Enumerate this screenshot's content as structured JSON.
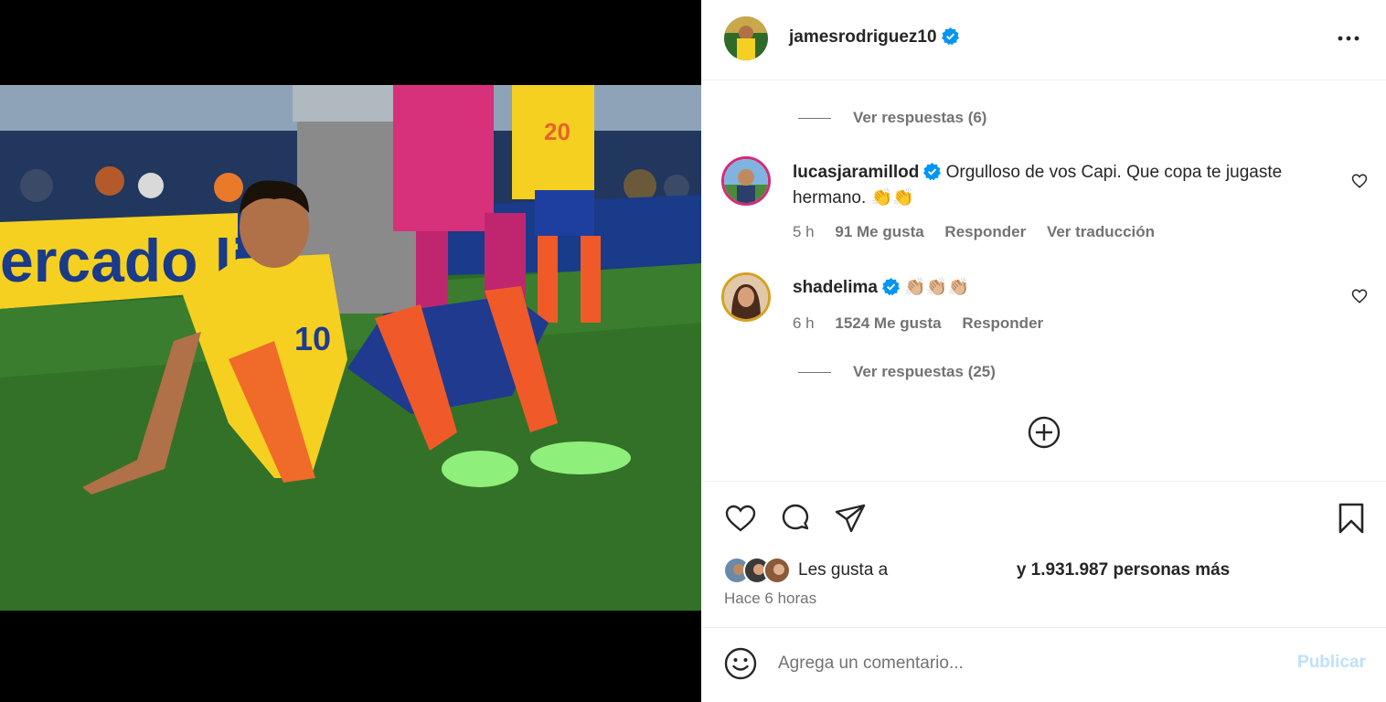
{
  "post": {
    "author": "jamesrodriguez10",
    "more_icon": "more-horizontal-icon"
  },
  "comments": {
    "replies_top": "Ver respuestas (6)",
    "items": [
      {
        "username": "lucasjaramillod",
        "text": "Orgulloso de vos Capi. Que copa te jugaste hermano. 👏👏",
        "time": "5 h",
        "likes": "91 Me gusta",
        "reply": "Responder",
        "translate": "Ver traducción"
      },
      {
        "username": "shadelima",
        "text": "👏🏼👏🏼👏🏼",
        "time": "6 h",
        "likes": "1524 Me gusta",
        "reply": "Responder"
      }
    ],
    "replies_bottom": "Ver respuestas (25)"
  },
  "actions": {
    "liked_by_prefix": "Les gusta a",
    "liked_by_count": "y 1.931.987 personas más",
    "time_ago": "Hace 6 horas"
  },
  "composer": {
    "placeholder": "Agrega un comentario...",
    "post_label": "Publicar"
  },
  "colors": {
    "verified": "#0095f6",
    "text": "#262626",
    "secondary": "#737373",
    "post_disabled": "#c0dffd",
    "jersey_yellow": "#f5d020",
    "sock_orange": "#f05a28"
  }
}
